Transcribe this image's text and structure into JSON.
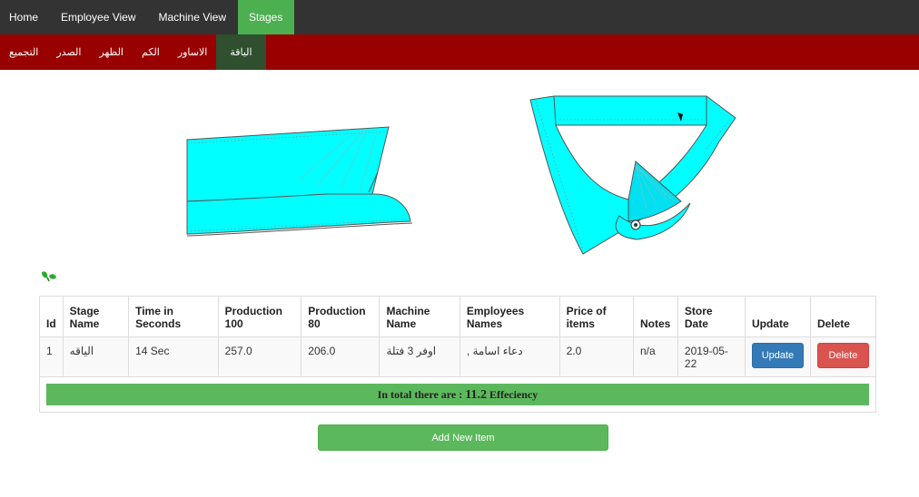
{
  "topnav": {
    "items": [
      {
        "label": "Home"
      },
      {
        "label": "Employee View"
      },
      {
        "label": "Machine View"
      },
      {
        "label": "Stages"
      }
    ],
    "active_index": 3,
    "background": "#333333",
    "active_color": "#4caf50"
  },
  "subnav": {
    "items": [
      {
        "label": "التجميع"
      },
      {
        "label": "الصدر"
      },
      {
        "label": "الظهر"
      },
      {
        "label": "الكم"
      },
      {
        "label": "الاساور"
      },
      {
        "label": "الياقة"
      }
    ],
    "active_label": "الياقة",
    "background": "#990000",
    "active_color": "#2f4f2f"
  },
  "figures": {
    "fill_color": "#00ffff",
    "left_figure": "collar-band-illustration",
    "right_figure": "collar-illustration",
    "logo_icon": "green-leaf-icon"
  },
  "table": {
    "headers": [
      "Id",
      "Stage Name",
      "Time in Seconds",
      "Production 100",
      "Production 80",
      "Machine Name",
      "Employees Names",
      "Price of items",
      "Notes",
      "Store Date",
      "Update",
      "Delete"
    ],
    "rows": [
      {
        "id": "1",
        "stage_name": "الياقه",
        "time": "14 Sec",
        "production_100": "257.0",
        "production_80": "206.0",
        "machine_name": "اوفر 3 فتلة",
        "employees": "دعاء اسامة ,",
        "price": "2.0",
        "notes": "n/a",
        "store_date": "2019-05-22",
        "update_label": "Update",
        "delete_label": "Delete"
      }
    ],
    "total": {
      "prefix": "In total there are :",
      "value": "11.2",
      "suffix": "Effeciency"
    }
  },
  "add_button": {
    "label": "Add New Item"
  }
}
